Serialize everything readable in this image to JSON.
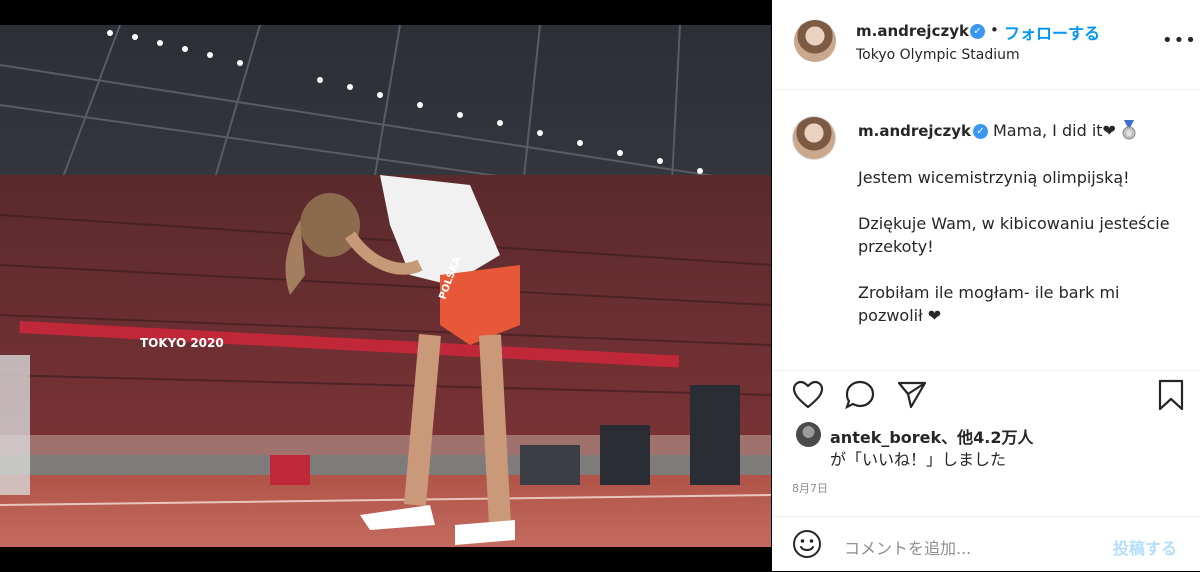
{
  "header": {
    "username": "m.andrejczyk",
    "separator": "•",
    "follow_label": "フォローする",
    "location": "Tokyo Olympic Stadium",
    "more_icon": "more-options-icon"
  },
  "caption": {
    "username": "m.andrejczyk",
    "first_line": "Mama, I did it❤",
    "body": "Jestem wicemistrzynią olimpijską!\n\nDziękuje Wam, w kibicowaniu jesteście przekoty!\n\nZrobiłam ile mogłam- ile bark mi pozwolił ❤"
  },
  "photo": {
    "banner_text": "TOKYO 2020",
    "shorts_text": "POLSKA"
  },
  "likes": {
    "line1": "antek_borek、他4.2万人",
    "line2": "が「いいね！」しました"
  },
  "date": "8月7日",
  "comment": {
    "placeholder": "コメントを追加...",
    "post_label": "投稿する"
  },
  "colors": {
    "link_blue": "#0095f6",
    "verified_blue": "#3897f0",
    "post_disabled": "#b2dffc"
  }
}
